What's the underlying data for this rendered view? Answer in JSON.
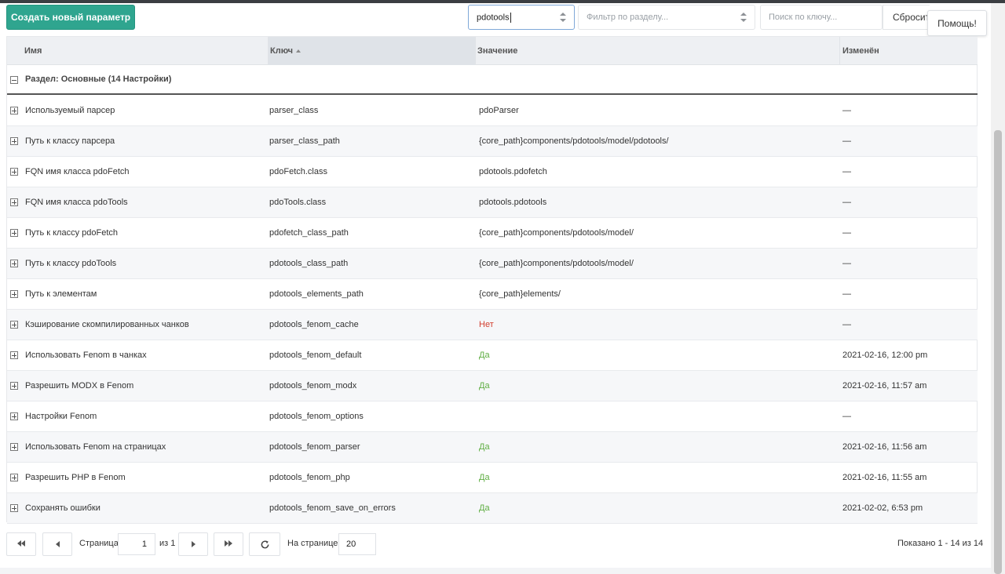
{
  "toolbar": {
    "create_label": "Создать новый параметр",
    "namespace_value": "pdotools",
    "area_placeholder": "Фильтр по разделу...",
    "search_placeholder": "Поиск по ключу...",
    "reset_label": "Сбросить",
    "help_label": "Помощь!"
  },
  "grid": {
    "columns": {
      "name": "Имя",
      "key": "Ключ",
      "value": "Значение",
      "edited": "Изменён"
    },
    "group_label": "Раздел: Основные (14 Настройки)",
    "rows": [
      {
        "name": "Используемый парсер",
        "key": "parser_class",
        "value": "pdoParser",
        "value_style": "plain",
        "edited": "—"
      },
      {
        "name": "Путь к классу парсера",
        "key": "parser_class_path",
        "value": "{core_path}components/pdotools/model/pdotools/",
        "value_style": "plain",
        "edited": "—"
      },
      {
        "name": "FQN имя класса pdoFetch",
        "key": "pdoFetch.class",
        "value": "pdotools.pdofetch",
        "value_style": "plain",
        "edited": "—"
      },
      {
        "name": "FQN имя класса pdoTools",
        "key": "pdoTools.class",
        "value": "pdotools.pdotools",
        "value_style": "plain",
        "edited": "—"
      },
      {
        "name": "Путь к классу pdoFetch",
        "key": "pdofetch_class_path",
        "value": "{core_path}components/pdotools/model/",
        "value_style": "plain",
        "edited": "—"
      },
      {
        "name": "Путь к классу pdoTools",
        "key": "pdotools_class_path",
        "value": "{core_path}components/pdotools/model/",
        "value_style": "plain",
        "edited": "—"
      },
      {
        "name": "Путь к элементам",
        "key": "pdotools_elements_path",
        "value": "{core_path}elements/",
        "value_style": "plain",
        "edited": "—"
      },
      {
        "name": "Кэширование скомпилированных чанков",
        "key": "pdotools_fenom_cache",
        "value": "Нет",
        "value_style": "no",
        "edited": "—"
      },
      {
        "name": "Использовать Fenom в чанках",
        "key": "pdotools_fenom_default",
        "value": "Да",
        "value_style": "yes",
        "edited": "2021-02-16, 12:00 pm"
      },
      {
        "name": "Разрешить MODX в Fenom",
        "key": "pdotools_fenom_modx",
        "value": "Да",
        "value_style": "yes",
        "edited": "2021-02-16, 11:57 am"
      },
      {
        "name": "Настройки Fenom",
        "key": "pdotools_fenom_options",
        "value": "",
        "value_style": "plain",
        "edited": "—"
      },
      {
        "name": "Использовать Fenom на страницах",
        "key": "pdotools_fenom_parser",
        "value": "Да",
        "value_style": "yes",
        "edited": "2021-02-16, 11:56 am"
      },
      {
        "name": "Разрешить PHP в Fenom",
        "key": "pdotools_fenom_php",
        "value": "Да",
        "value_style": "yes",
        "edited": "2021-02-16, 11:55 am"
      },
      {
        "name": "Сохранять ошибки",
        "key": "pdotools_fenom_save_on_errors",
        "value": "Да",
        "value_style": "yes",
        "edited": "2021-02-02, 6:53 pm"
      }
    ]
  },
  "pager": {
    "page_label": "Страница",
    "page_value": "1",
    "of_label": "из 1",
    "per_page_label": "На странице:",
    "per_page_value": "20",
    "summary": "Показано 1 - 14 из 14"
  },
  "colors": {
    "accent": "#2fa58f",
    "yes": "#5fae43",
    "no": "#d23f2f"
  }
}
